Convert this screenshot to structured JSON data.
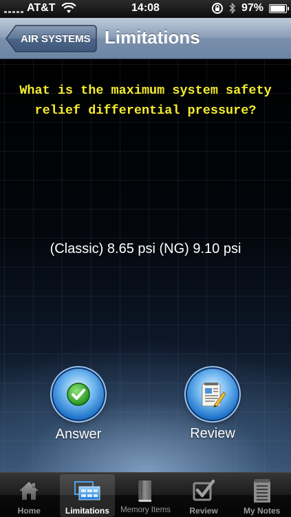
{
  "status_bar": {
    "carrier": "AT&T",
    "time": "14:08",
    "battery": "97%",
    "battery_level": 0.97
  },
  "nav": {
    "back_label": "AIR SYSTEMS",
    "title": "Limitations"
  },
  "main": {
    "question": "What is the maximum system safety relief differential pressure?",
    "answer": "(Classic) 8.65 psi (NG) 9.10 psi",
    "answer_button_label": "Answer",
    "review_button_label": "Review"
  },
  "tabs": [
    {
      "label": "Home",
      "icon": "house-icon",
      "active": false
    },
    {
      "label": "Limitations",
      "icon": "limitations-icon",
      "active": true
    },
    {
      "label": "Memory Items",
      "icon": "book-icon",
      "active": false
    },
    {
      "label": "Review",
      "icon": "checkbox-icon",
      "active": false
    },
    {
      "label": "My Notes",
      "icon": "notepad-icon",
      "active": false
    }
  ],
  "colors": {
    "question_text": "#f4ec2c",
    "nav_bar": "#7b90ad"
  }
}
